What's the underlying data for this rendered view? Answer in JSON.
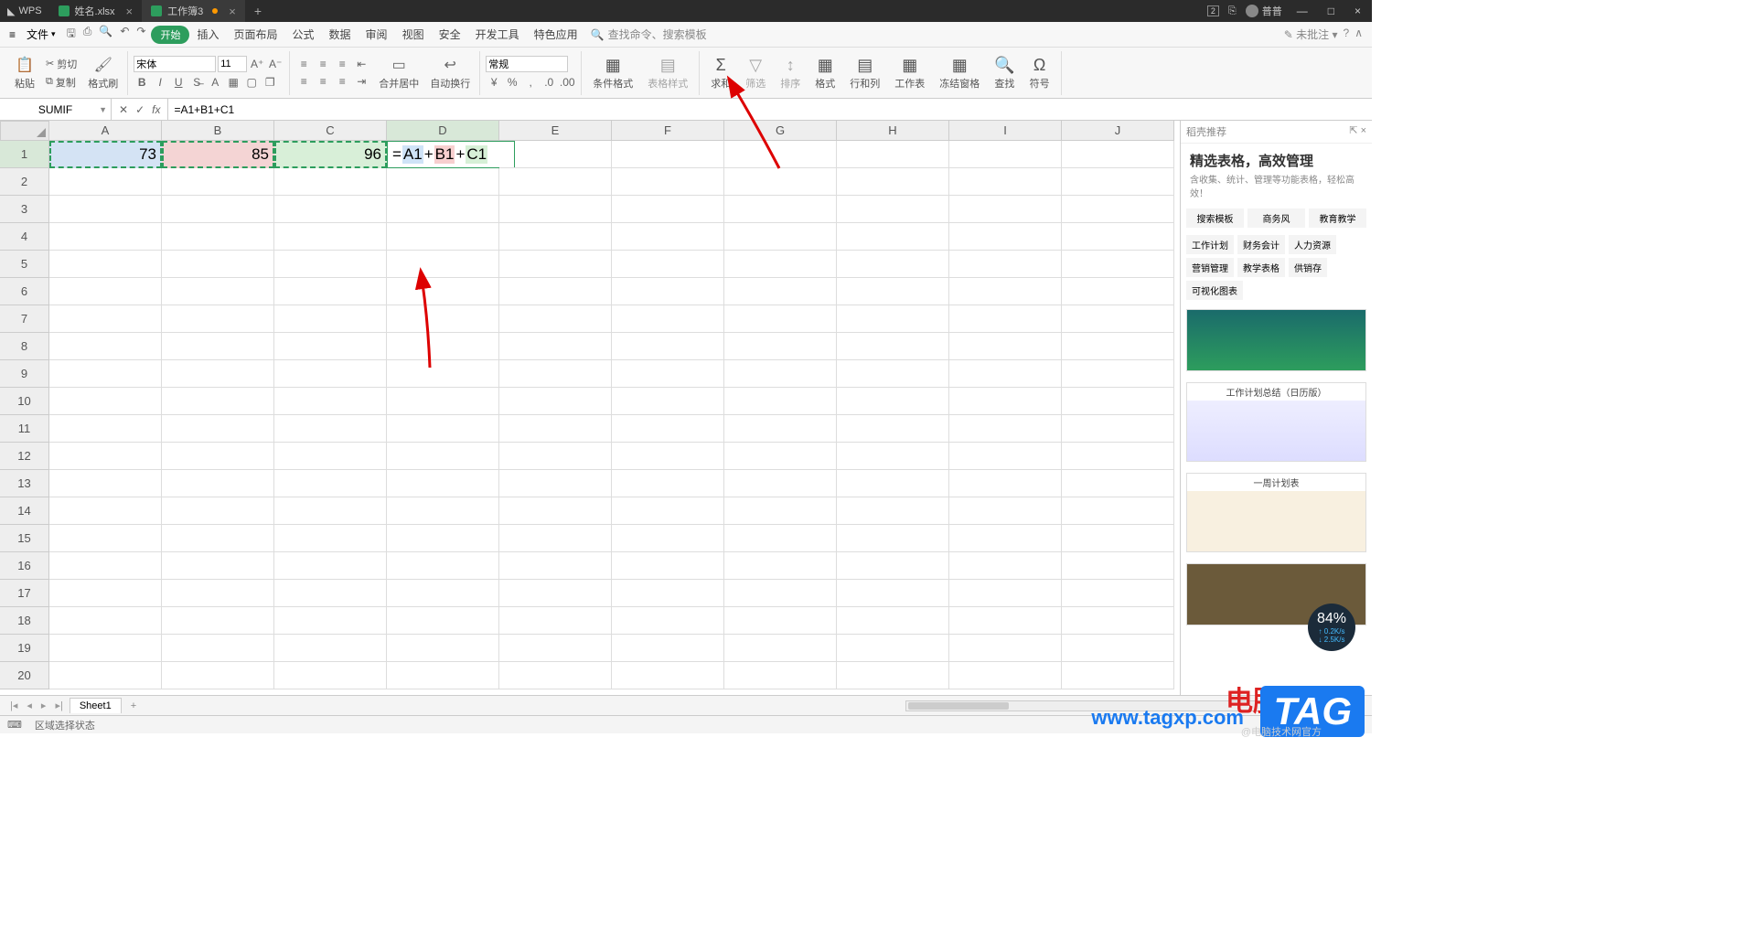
{
  "titlebar": {
    "brand": "WPS",
    "tabs": [
      {
        "label": "姓名.xlsx",
        "active": false
      },
      {
        "label": "工作簿3",
        "active": true,
        "modified": true
      }
    ],
    "user": "普普",
    "badge": "2"
  },
  "menu": {
    "file": "文件",
    "items": [
      "开始",
      "插入",
      "页面布局",
      "公式",
      "数据",
      "审阅",
      "视图",
      "安全",
      "开发工具",
      "特色应用"
    ],
    "search_placeholder": "查找命令、搜索模板",
    "comment": "未批注"
  },
  "ribbon": {
    "paste": "粘贴",
    "cut": "剪切",
    "copy": "复制",
    "format_painter": "格式刷",
    "font_name": "宋体",
    "font_size": "11",
    "merge_center": "合并居中",
    "auto_wrap": "自动换行",
    "number_format": "常规",
    "cond_fmt": "条件格式",
    "table_style": "表格样式",
    "sum": "求和",
    "filter": "筛选",
    "sort": "排序",
    "format": "格式",
    "rowcol": "行和列",
    "worksheet": "工作表",
    "freeze": "冻结窗格",
    "find": "查找",
    "symbol": "符号"
  },
  "namebox": "SUMIF",
  "formula": "=A1+B1+C1",
  "columns": [
    "A",
    "B",
    "C",
    "D",
    "E",
    "F",
    "G",
    "H",
    "I",
    "J"
  ],
  "rows": [
    "1",
    "2",
    "3",
    "4",
    "5",
    "6",
    "7",
    "8",
    "9",
    "10",
    "11",
    "12",
    "13",
    "14",
    "15",
    "16",
    "17",
    "18",
    "19",
    "20"
  ],
  "cells": {
    "a1": "73",
    "b1": "85",
    "c1": "96",
    "d1_parts": {
      "eq": "=",
      "r1": "A1",
      "p1": "+",
      "r2": "B1",
      "p2": "+",
      "r3": "C1"
    }
  },
  "rpanel": {
    "header": "稻壳推荐",
    "title": "精选表格，高效管理",
    "subtitle": "含收集、统计、管理等功能表格，轻松高效！",
    "tabs": [
      "搜索模板",
      "商务风",
      "教育教学"
    ],
    "tags": [
      "工作计划",
      "财务会计",
      "人力资源",
      "营销管理",
      "教学表格",
      "供销存",
      "可视化图表"
    ],
    "tpl2_caption": "工作计划总结（日历版）",
    "tpl3_caption": "一周计划表"
  },
  "sheettab": "Sheet1",
  "statusbar": {
    "mode": "区域选择状态"
  },
  "overlay": {
    "txt": "电脑技术网",
    "url": "www.tagxp.com",
    "tag": "TAG",
    "pct": "84%",
    "up": "0.2K/s",
    "down": "2.5K/s",
    "weibo": "@电脑技术网官方"
  }
}
